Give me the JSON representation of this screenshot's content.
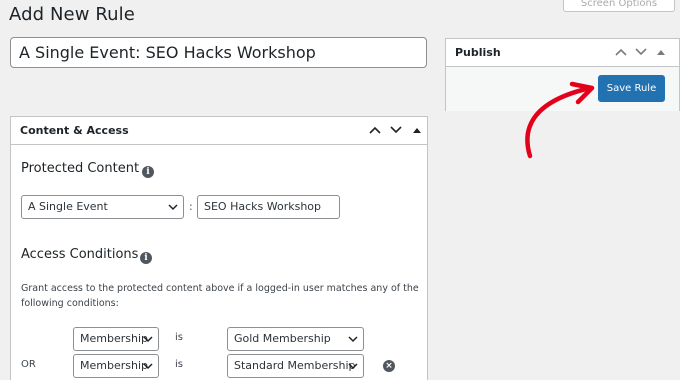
{
  "page": {
    "title": "Add New Rule",
    "screen_options": "Screen Options"
  },
  "rule_title": {
    "value": "A Single Event: SEO Hacks Workshop"
  },
  "publish": {
    "title": "Publish",
    "save_label": "Save Rule"
  },
  "content_access": {
    "title": "Content & Access",
    "protected_content": {
      "heading": "Protected Content",
      "type_selected": "A Single Event",
      "separator": ":",
      "value": "SEO Hacks Workshop"
    },
    "access_conditions": {
      "heading": "Access Conditions",
      "description": "Grant access to the protected content above if a logged-in user matches any of the following conditions:",
      "rows": [
        {
          "connector": "",
          "field": "Membership",
          "operator": "is",
          "value": "Gold Membership"
        },
        {
          "connector": "OR",
          "field": "Membership",
          "operator": "is",
          "value": "Standard Membership"
        }
      ]
    }
  },
  "colors": {
    "primary": "#2271b1",
    "annotation_arrow": "#e3001b"
  }
}
